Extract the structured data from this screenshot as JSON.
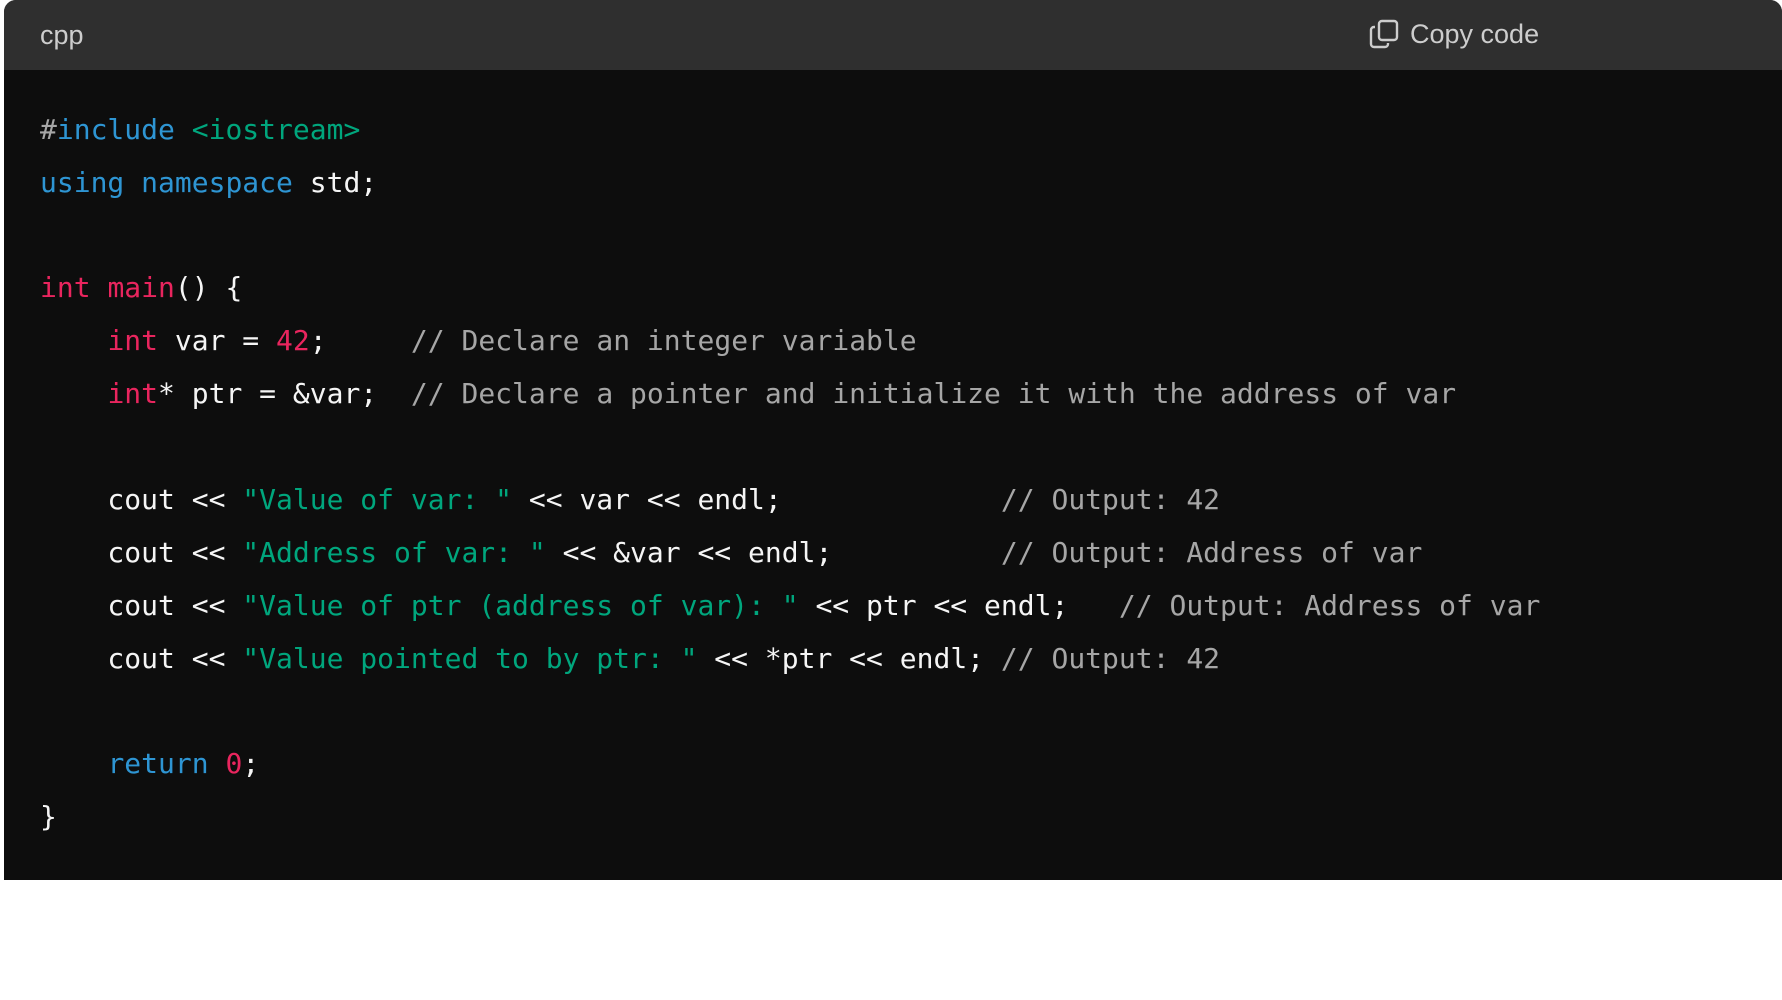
{
  "header": {
    "language": "cpp",
    "copy_label": "Copy code",
    "copy_icon": "copy-icon"
  },
  "colors": {
    "keyword": "#2e95d3",
    "type": "#e9255e",
    "string": "#00a67d",
    "comment": "#a6a6a6",
    "plain": "#f5f5f5",
    "background": "#0d0d0d",
    "header_background": "#2f2f2f"
  },
  "code": {
    "lines": [
      [
        {
          "t": "meta",
          "v": "#"
        },
        {
          "t": "keyword",
          "v": "include"
        },
        {
          "t": "plain",
          "v": " "
        },
        {
          "t": "string",
          "v": "<iostream>"
        }
      ],
      [
        {
          "t": "keyword",
          "v": "using"
        },
        {
          "t": "plain",
          "v": " "
        },
        {
          "t": "keyword",
          "v": "namespace"
        },
        {
          "t": "plain",
          "v": " std;"
        }
      ],
      [],
      [
        {
          "t": "type",
          "v": "int"
        },
        {
          "t": "plain",
          "v": " "
        },
        {
          "t": "func",
          "v": "main"
        },
        {
          "t": "plain",
          "v": "() {"
        }
      ],
      [
        {
          "t": "plain",
          "v": "    "
        },
        {
          "t": "type",
          "v": "int"
        },
        {
          "t": "plain",
          "v": " var = "
        },
        {
          "t": "number",
          "v": "42"
        },
        {
          "t": "plain",
          "v": ";     "
        },
        {
          "t": "comment",
          "v": "// Declare an integer variable"
        }
      ],
      [
        {
          "t": "plain",
          "v": "    "
        },
        {
          "t": "type",
          "v": "int"
        },
        {
          "t": "plain",
          "v": "* ptr = &var;  "
        },
        {
          "t": "comment",
          "v": "// Declare a pointer and initialize it with the address of var"
        }
      ],
      [],
      [
        {
          "t": "plain",
          "v": "    cout << "
        },
        {
          "t": "string",
          "v": "\"Value of var: \""
        },
        {
          "t": "plain",
          "v": " << var << endl;             "
        },
        {
          "t": "comment",
          "v": "// Output: 42"
        }
      ],
      [
        {
          "t": "plain",
          "v": "    cout << "
        },
        {
          "t": "string",
          "v": "\"Address of var: \""
        },
        {
          "t": "plain",
          "v": " << &var << endl;          "
        },
        {
          "t": "comment",
          "v": "// Output: Address of var"
        }
      ],
      [
        {
          "t": "plain",
          "v": "    cout << "
        },
        {
          "t": "string",
          "v": "\"Value of ptr (address of var): \""
        },
        {
          "t": "plain",
          "v": " << ptr << endl;   "
        },
        {
          "t": "comment",
          "v": "// Output: Address of var"
        }
      ],
      [
        {
          "t": "plain",
          "v": "    cout << "
        },
        {
          "t": "string",
          "v": "\"Value pointed to by ptr: \""
        },
        {
          "t": "plain",
          "v": " << *ptr << endl; "
        },
        {
          "t": "comment",
          "v": "// Output: 42"
        }
      ],
      [],
      [
        {
          "t": "plain",
          "v": "    "
        },
        {
          "t": "keyword",
          "v": "return"
        },
        {
          "t": "plain",
          "v": " "
        },
        {
          "t": "number",
          "v": "0"
        },
        {
          "t": "plain",
          "v": ";"
        }
      ],
      [
        {
          "t": "plain",
          "v": "}"
        }
      ]
    ]
  }
}
